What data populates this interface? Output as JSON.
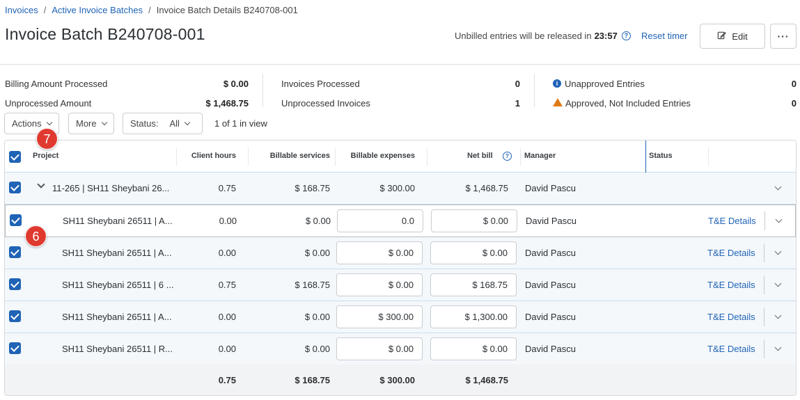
{
  "breadcrumb": {
    "items": [
      "Invoices",
      "Active Invoice Batches"
    ],
    "current": "Invoice Batch Details B240708-001",
    "separator": "/"
  },
  "title": "Invoice Batch B240708-001",
  "timer": {
    "text": "Unbilled entries will be released in",
    "time": "23:57",
    "help_glyph": "?",
    "reset_label": "Reset timer"
  },
  "toolbar": {
    "edit_label": "Edit",
    "edit_icon": "pencil-icon",
    "more_glyph": "···"
  },
  "summary": {
    "col1": [
      {
        "label": "Billing Amount Processed",
        "value": "$ 0.00"
      },
      {
        "label": "Unprocessed Amount",
        "value": "$ 1,468.75"
      }
    ],
    "col2": [
      {
        "label": "Invoices Processed",
        "value": "0"
      },
      {
        "label": "Unprocessed Invoices",
        "value": "1"
      }
    ],
    "col3": [
      {
        "label": "Unapproved Entries",
        "value": "0",
        "icon": "info-icon",
        "icon_glyph": "i"
      },
      {
        "label": "Approved, Not Included Entries",
        "value": "0",
        "icon": "warning-icon"
      }
    ]
  },
  "filters": {
    "actions_label": "Actions",
    "more_label": "More",
    "status_label": "Status:",
    "status_value": "All",
    "count_text": "1 of 1 in view"
  },
  "badges": {
    "seven": "7",
    "six": "6"
  },
  "table": {
    "headers": {
      "project": "Project",
      "client_hours": "Client hours",
      "billable_services": "Billable services",
      "billable_expenses": "Billable expenses",
      "net_bill": "Net bill",
      "net_bill_help": "?",
      "manager": "Manager",
      "status": "Status"
    },
    "parent": {
      "project": "11-265 | SH11 Sheybani 26...",
      "client_hours": "0.75",
      "billable_services": "$ 168.75",
      "billable_expenses": "$ 300.00",
      "net_bill": "$ 1,468.75",
      "manager": "David Pascu"
    },
    "rows": [
      {
        "project": "SH11 Sheybani 26511 | A...",
        "client_hours": "0.00",
        "billable_services": "$ 0.00",
        "billable_expenses": "0.0",
        "net_bill": "$ 0.00",
        "manager": "David Pascu",
        "link": "T&E Details"
      },
      {
        "project": "SH11 Sheybani 26511 | A...",
        "client_hours": "0.00",
        "billable_services": "$ 0.00",
        "billable_expenses": "$ 0.00",
        "net_bill": "$ 0.00",
        "manager": "David Pascu",
        "link": "T&E Details"
      },
      {
        "project": "SH11 Sheybani 26511 | 6 ...",
        "client_hours": "0.75",
        "billable_services": "$ 168.75",
        "billable_expenses": "$ 0.00",
        "net_bill": "$ 168.75",
        "manager": "David Pascu",
        "link": "T&E Details"
      },
      {
        "project": "SH11 Sheybani 26511 | A...",
        "client_hours": "0.00",
        "billable_services": "$ 0.00",
        "billable_expenses": "$ 300.00",
        "net_bill": "$ 1,300.00",
        "manager": "David Pascu",
        "link": "T&E Details"
      },
      {
        "project": "SH11 Sheybani 26511 | R...",
        "client_hours": "0.00",
        "billable_services": "$ 0.00",
        "billable_expenses": "$ 0.00",
        "net_bill": "$ 0.00",
        "manager": "David Pascu",
        "link": "T&E Details"
      }
    ],
    "totals": {
      "client_hours": "0.75",
      "billable_services": "$ 168.75",
      "billable_expenses": "$ 300.00",
      "net_bill": "$ 1,468.75"
    }
  },
  "colors": {
    "accent": "#1f63b6",
    "badge": "#e03a30",
    "warning": "#e07b16"
  }
}
